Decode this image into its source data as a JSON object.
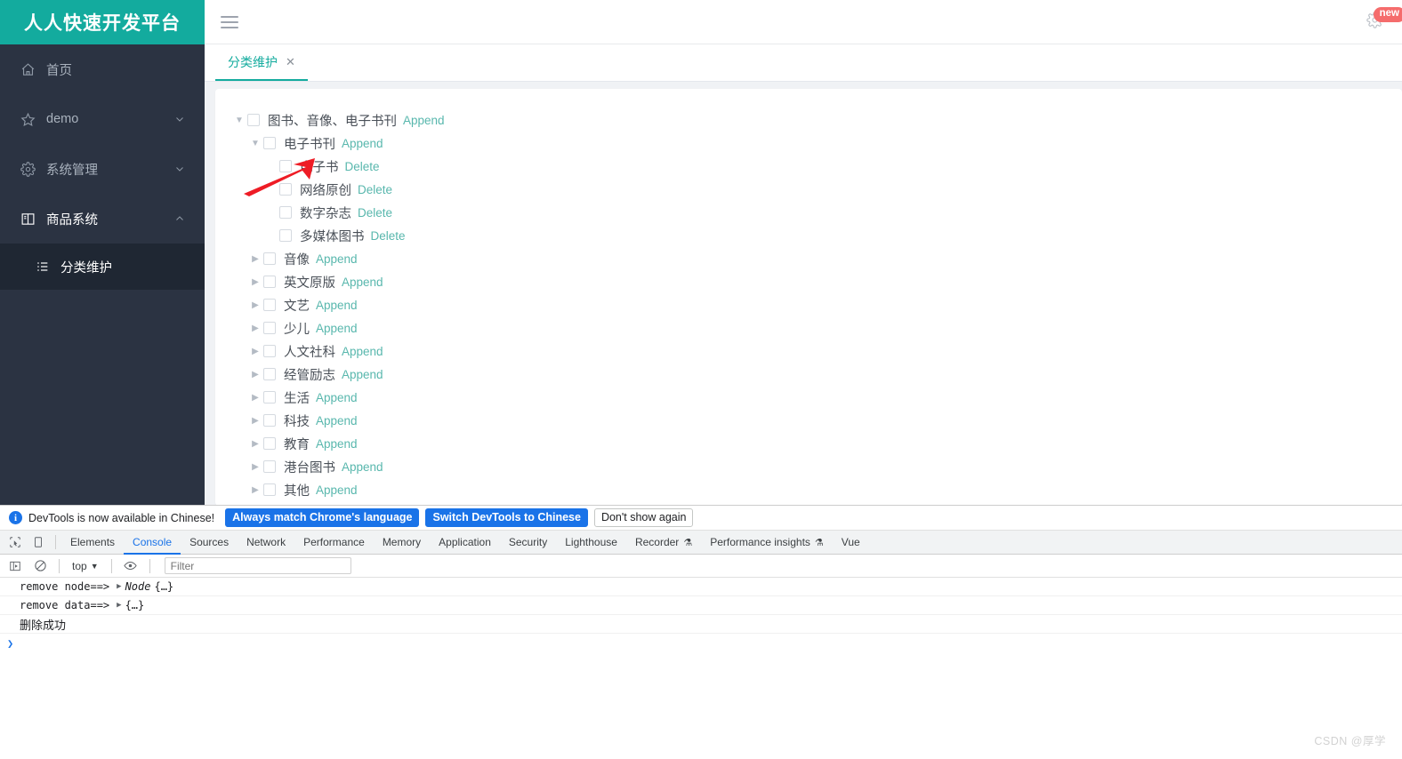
{
  "brand": {
    "title": "人人快速开发平台"
  },
  "sidebar": {
    "items": [
      {
        "label": "首页",
        "icon": "home-icon",
        "arrow": ""
      },
      {
        "label": "demo",
        "icon": "star-icon",
        "arrow": "chevron-down-icon"
      },
      {
        "label": "系统管理",
        "icon": "gear-icon",
        "arrow": "chevron-down-icon"
      },
      {
        "label": "商品系统",
        "icon": "book-icon",
        "arrow": "chevron-up-icon"
      }
    ],
    "submenu": [
      {
        "label": "分类维护",
        "icon": "list-icon"
      }
    ]
  },
  "topbar": {
    "menu_toggle": "hamburger-icon",
    "gear": "gear-icon",
    "badge": "new"
  },
  "tabs": [
    {
      "label": "分类维护",
      "close": "✕",
      "active": true
    }
  ],
  "tree": {
    "action_append": "Append",
    "action_delete": "Delete",
    "nodes": [
      {
        "level": 0,
        "caret": "down",
        "label": "图书、音像、电子书刊",
        "action": "Append"
      },
      {
        "level": 1,
        "caret": "down",
        "label": "电子书刊",
        "action": "Append"
      },
      {
        "level": 2,
        "caret": "none",
        "label": "电子书",
        "action": "Delete"
      },
      {
        "level": 2,
        "caret": "none",
        "label": "网络原创",
        "action": "Delete"
      },
      {
        "level": 2,
        "caret": "none",
        "label": "数字杂志",
        "action": "Delete"
      },
      {
        "level": 2,
        "caret": "none",
        "label": "多媒体图书",
        "action": "Delete"
      },
      {
        "level": 1,
        "caret": "right",
        "label": "音像",
        "action": "Append"
      },
      {
        "level": 1,
        "caret": "right",
        "label": "英文原版",
        "action": "Append"
      },
      {
        "level": 1,
        "caret": "right",
        "label": "文艺",
        "action": "Append"
      },
      {
        "level": 1,
        "caret": "right",
        "label": "少儿",
        "action": "Append"
      },
      {
        "level": 1,
        "caret": "right",
        "label": "人文社科",
        "action": "Append"
      },
      {
        "level": 1,
        "caret": "right",
        "label": "经管励志",
        "action": "Append"
      },
      {
        "level": 1,
        "caret": "right",
        "label": "生活",
        "action": "Append"
      },
      {
        "level": 1,
        "caret": "right",
        "label": "科技",
        "action": "Append"
      },
      {
        "level": 1,
        "caret": "right",
        "label": "教育",
        "action": "Append"
      },
      {
        "level": 1,
        "caret": "right",
        "label": "港台图书",
        "action": "Append"
      },
      {
        "level": 1,
        "caret": "right",
        "label": "其他",
        "action": "Append"
      }
    ]
  },
  "devtools": {
    "notice": {
      "icon": "info-icon",
      "text": "DevTools is now available in Chinese!",
      "btn_always": "Always match Chrome's language",
      "btn_switch": "Switch DevTools to Chinese",
      "btn_dismiss": "Don't show again"
    },
    "tabs": [
      {
        "label": "Elements",
        "active": false,
        "flask": false
      },
      {
        "label": "Console",
        "active": true,
        "flask": false
      },
      {
        "label": "Sources",
        "active": false,
        "flask": false
      },
      {
        "label": "Network",
        "active": false,
        "flask": false
      },
      {
        "label": "Performance",
        "active": false,
        "flask": false
      },
      {
        "label": "Memory",
        "active": false,
        "flask": false
      },
      {
        "label": "Application",
        "active": false,
        "flask": false
      },
      {
        "label": "Security",
        "active": false,
        "flask": false
      },
      {
        "label": "Lighthouse",
        "active": false,
        "flask": false
      },
      {
        "label": "Recorder",
        "active": false,
        "flask": true
      },
      {
        "label": "Performance insights",
        "active": false,
        "flask": true
      },
      {
        "label": "Vue",
        "active": false,
        "flask": false
      }
    ],
    "filterbar": {
      "context": "top",
      "filter_placeholder": "Filter",
      "filter_value": ""
    },
    "console_lines": [
      {
        "text": "remove node==>",
        "disc": "▶",
        "type": "Node",
        "braces": "{…}",
        "cn": false
      },
      {
        "text": "remove data==>",
        "disc": "▶",
        "type": "",
        "braces": "{…}",
        "cn": false
      },
      {
        "text": "删除成功",
        "disc": "",
        "type": "",
        "braces": "",
        "cn": true
      }
    ],
    "prompt": "❯"
  },
  "watermark": "CSDN @厚学",
  "colors": {
    "brand_teal": "#13ab9e",
    "sidebar_bg": "#2b3342",
    "submenu_bg": "#1f2733",
    "action_link": "#58b7ad",
    "badge_red": "#f56c6c",
    "devtools_blue": "#1a73e8",
    "arrow_red": "#ee1c25"
  }
}
